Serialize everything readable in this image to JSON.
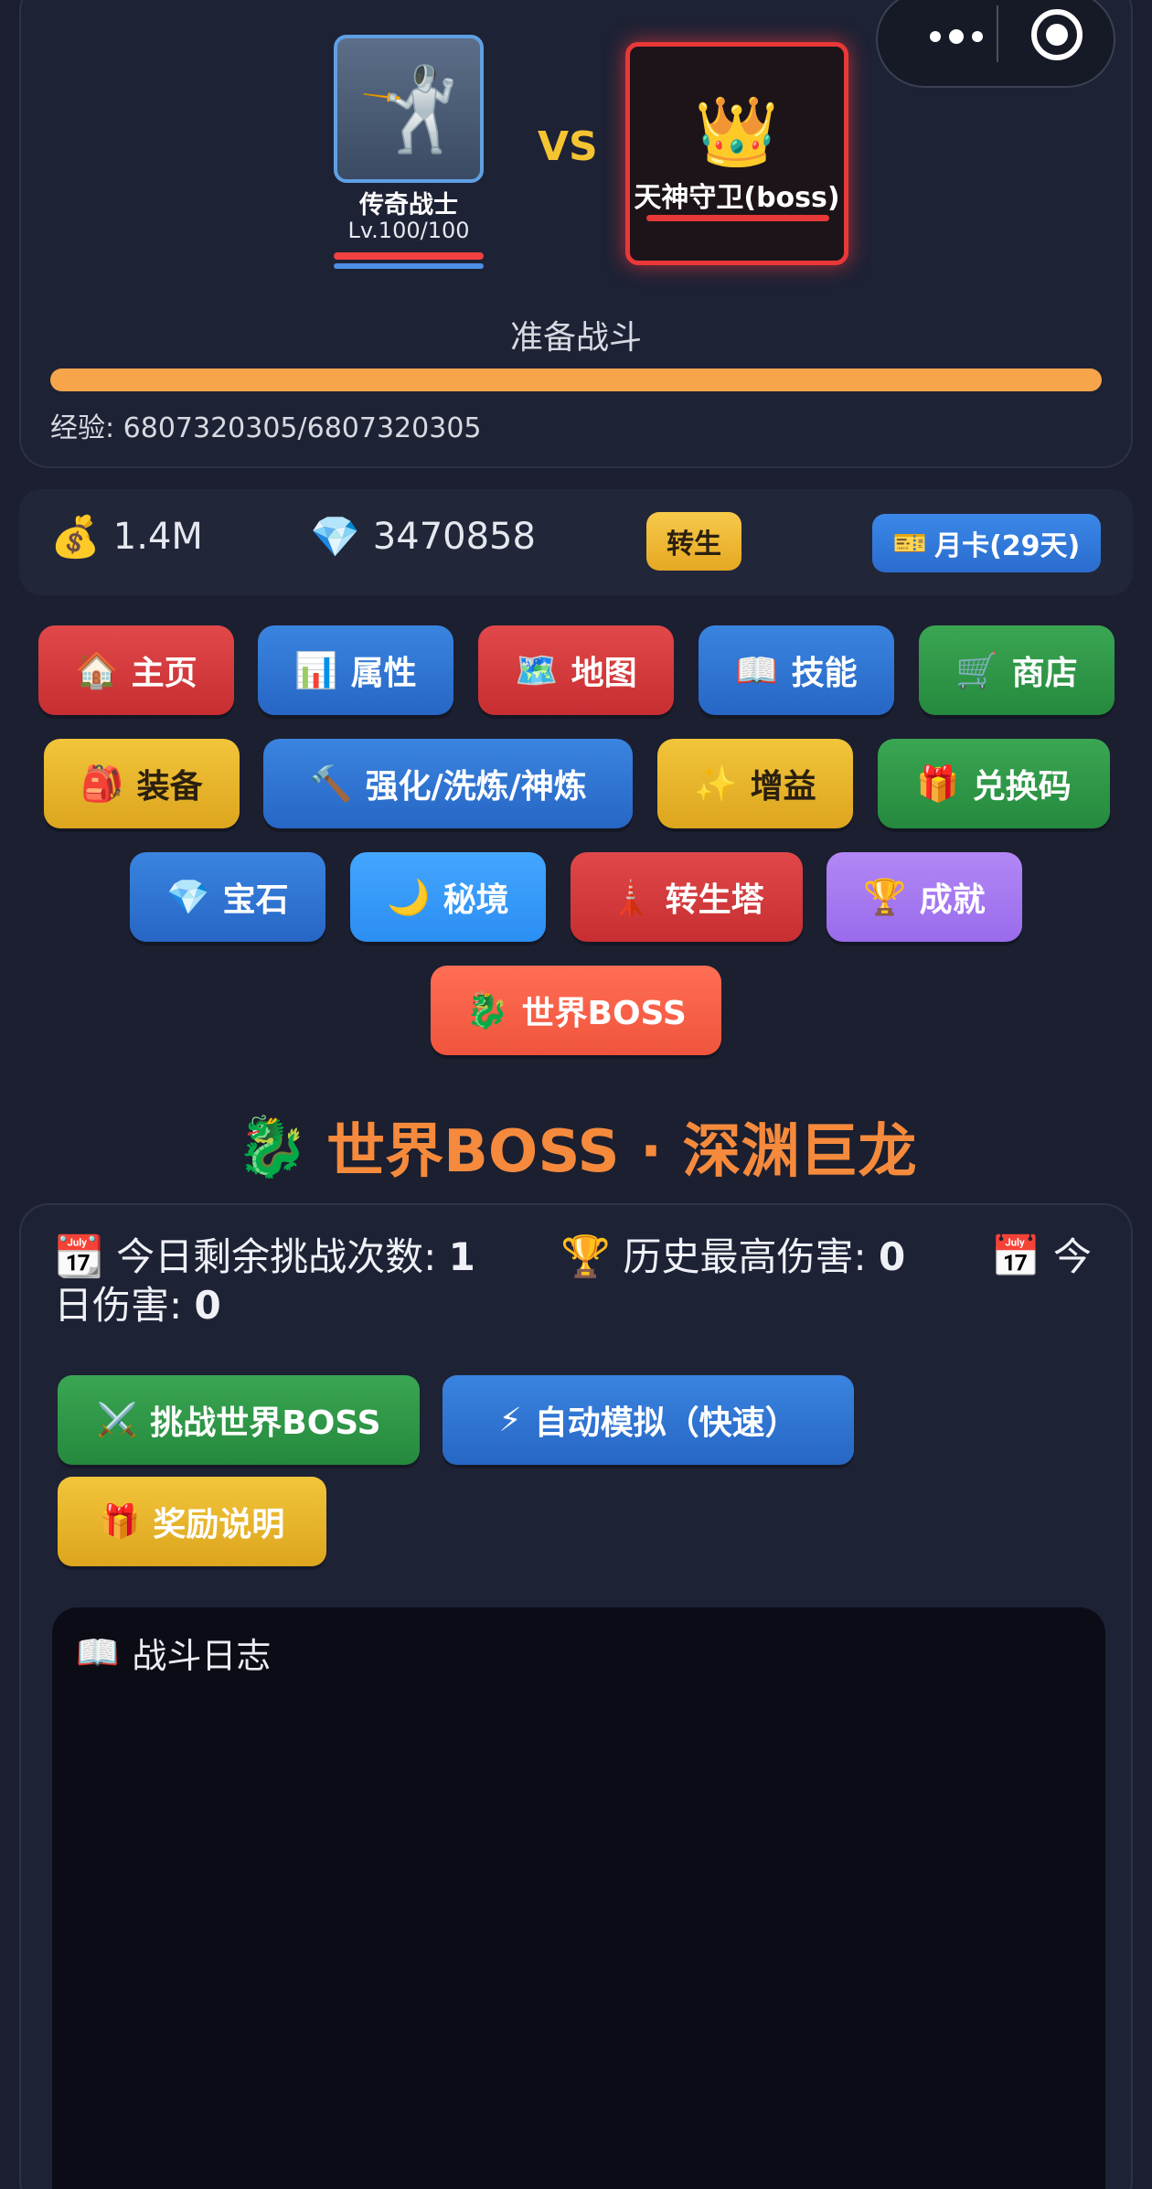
{
  "top_capsule": {
    "more_icon": "more-dots-icon",
    "close_icon": "target-circle-icon"
  },
  "player": {
    "name": "传奇战士",
    "level": "Lv.100/100",
    "avatar_icon": "🤺"
  },
  "vs": "VS",
  "boss": {
    "name": "天神守卫(boss)",
    "icon": "👑"
  },
  "battle_status": "准备战斗",
  "exp": {
    "text": "经验: 6807320305/6807320305",
    "progress": 1.0
  },
  "resources": {
    "gold_icon": "💰",
    "gold": "1.4M",
    "gem_icon": "💎",
    "gems": "3470858",
    "rebirth_label": "转生",
    "monthcard_icon": "🎫",
    "monthcard_label": "月卡(29天)"
  },
  "nav": {
    "home": {
      "icon": "🏠",
      "label": "主页"
    },
    "attributes": {
      "icon": "📊",
      "label": "属性"
    },
    "map": {
      "icon": "🗺️",
      "label": "地图"
    },
    "skills": {
      "icon": "📖",
      "label": "技能"
    },
    "shop": {
      "icon": "🛒",
      "label": "商店"
    },
    "equipment": {
      "icon": "🎒",
      "label": "装备"
    },
    "enhance": {
      "icon": "🔨",
      "label": "强化/洗炼/神炼"
    },
    "buff": {
      "icon": "✨",
      "label": "增益"
    },
    "redeem": {
      "icon": "🎁",
      "label": "兑换码"
    },
    "gems": {
      "icon": "💎",
      "label": "宝石"
    },
    "secret": {
      "icon": "🌙",
      "label": "秘境"
    },
    "tower": {
      "icon": "🗼",
      "label": "转生塔"
    },
    "achievement": {
      "icon": "🏆",
      "label": "成就"
    },
    "world_boss": {
      "icon": "🐉",
      "label": "世界BOSS"
    }
  },
  "world_boss_section": {
    "title_icon": "🐉",
    "title": "世界BOSS · 深渊巨龙",
    "remaining_icon": "📆",
    "remaining_label": "今日剩余挑战次数: ",
    "remaining_value": "1",
    "best_icon": "🏆",
    "best_label": "历史最高伤害: ",
    "best_value": "0",
    "today_icon": "📅",
    "today_label": "今日伤害: ",
    "today_value": "0",
    "challenge_icon": "⚔️",
    "challenge_label": "挑战世界BOSS",
    "auto_icon": "⚡",
    "auto_label": "自动模拟（快速）",
    "reward_icon": "🎁",
    "reward_label": "奖励说明",
    "log_icon": "📖",
    "log_title": "战斗日志"
  }
}
